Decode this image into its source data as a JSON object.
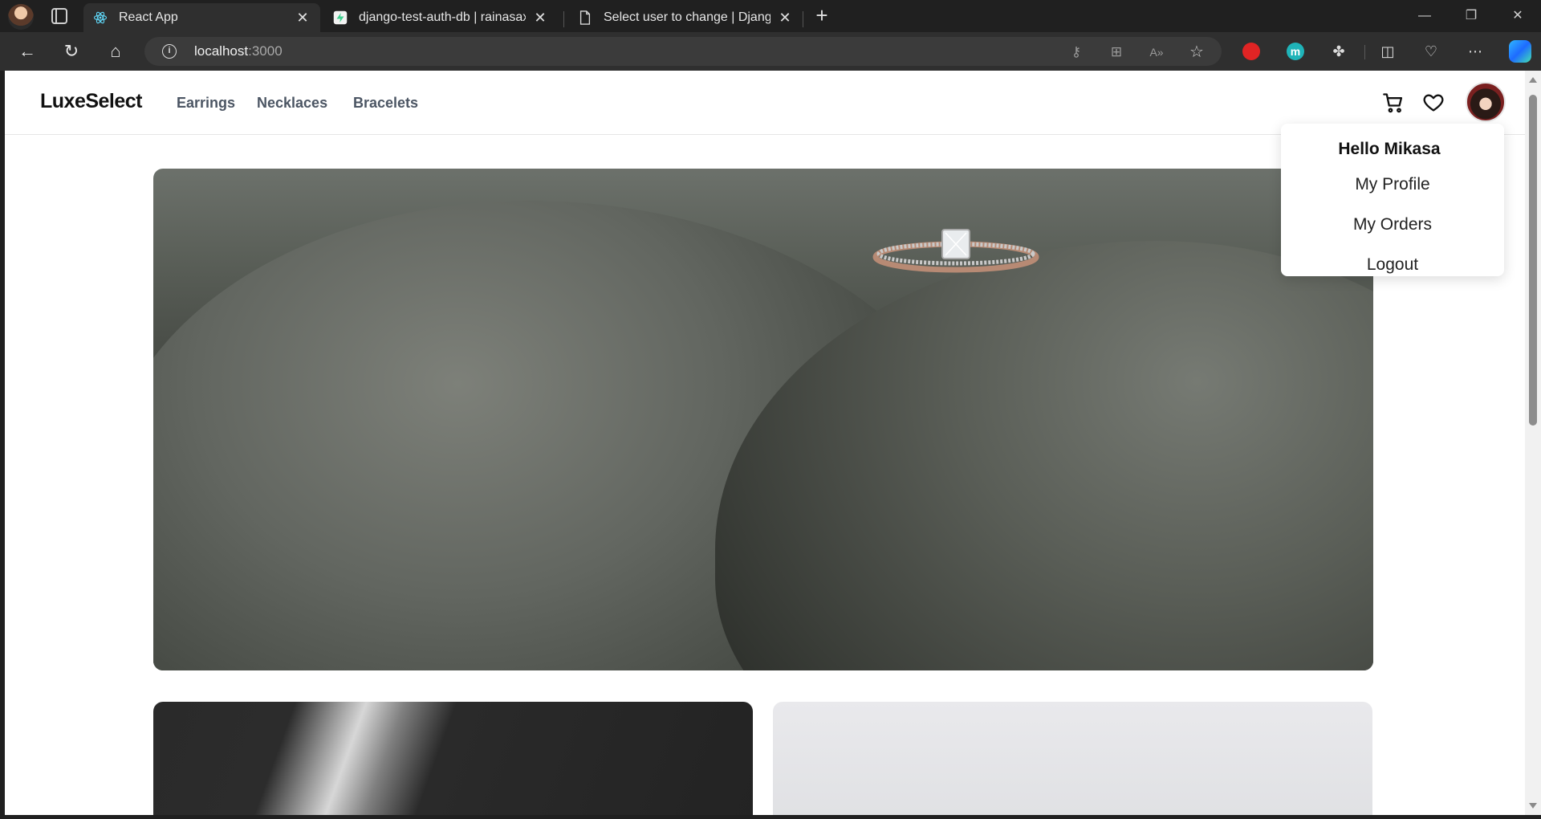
{
  "browser": {
    "tabs": [
      {
        "title": "React App",
        "icon": "react-icon",
        "active": true
      },
      {
        "title": "django-test-auth-db | rainasaxena",
        "icon": "supabase-icon",
        "active": false
      },
      {
        "title": "Select user to change | Django site admin",
        "icon": "page-icon",
        "active": false
      }
    ],
    "address": {
      "host": "localhost",
      "port": ":3000"
    }
  },
  "site": {
    "brand": "LuxeSelect",
    "nav": [
      "Earrings",
      "Necklaces",
      "Bracelets"
    ],
    "user_menu": {
      "greeting": "Hello Mikasa",
      "items": [
        "My Profile",
        "My Orders",
        "Logout"
      ]
    }
  },
  "colors": {
    "brand_text": "#111111",
    "nav_text": "#4b5563",
    "chrome_bg": "#202020",
    "toolbar_bg": "#2f2f2f"
  }
}
